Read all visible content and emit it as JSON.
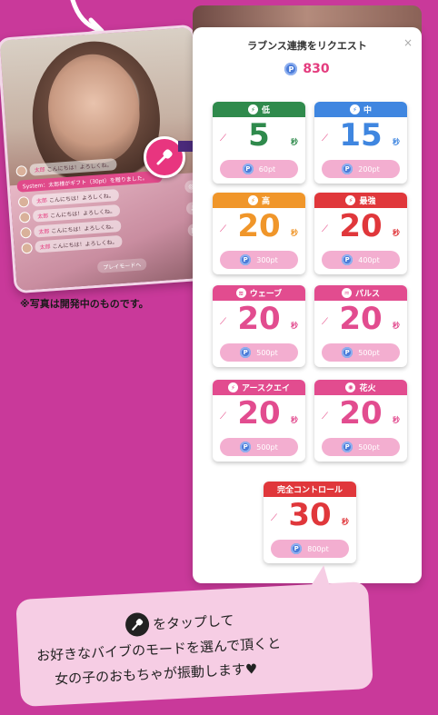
{
  "phone": {
    "system_msg": "System：太郎様がギフト（30pt）を贈りました。",
    "chat": [
      {
        "name": "太郎",
        "text": "こんにちは！よろしくね。"
      },
      {
        "name": "太郎",
        "text": "こんにちは！よろしくね。"
      },
      {
        "name": "太郎",
        "text": "こんにちは！よろしくね。"
      },
      {
        "name": "太郎",
        "text": "こんにちは！よろしくね。"
      },
      {
        "name": "太郎",
        "text": "こんにちは！よろしくね。"
      }
    ],
    "bottom_tag": "プレイモードへ"
  },
  "note": "※写真は開発中のものです。",
  "panel": {
    "title": "ラブンス連携をリクエスト",
    "close": "×",
    "coin": "P",
    "balance": "830",
    "unit": "秒",
    "options": [
      {
        "label": "低",
        "num": "5",
        "price": "60pt",
        "color": "#2f8a4c",
        "num_color": "#2f8a4c",
        "icon": "⚡"
      },
      {
        "label": "中",
        "num": "15",
        "price": "200pt",
        "color": "#3f86e0",
        "num_color": "#3f86e0",
        "icon": "⚡"
      },
      {
        "label": "高",
        "num": "20",
        "price": "300pt",
        "color": "#f0962a",
        "num_color": "#f0962a",
        "icon": "⚡"
      },
      {
        "label": "最強",
        "num": "20",
        "price": "400pt",
        "color": "#e0373b",
        "num_color": "#e0373b",
        "icon": "⚡"
      },
      {
        "label": "ウェーブ",
        "num": "20",
        "price": "500pt",
        "color": "#e24c8f",
        "num_color": "#e24c8f",
        "icon": "≋"
      },
      {
        "label": "パルス",
        "num": "20",
        "price": "500pt",
        "color": "#e24c8f",
        "num_color": "#e24c8f",
        "icon": "♒"
      },
      {
        "label": "アースクエイ",
        "num": "20",
        "price": "500pt",
        "color": "#e24c8f",
        "num_color": "#e24c8f",
        "icon": "⚡"
      },
      {
        "label": "花火",
        "num": "20",
        "price": "500pt",
        "color": "#e24c8f",
        "num_color": "#e24c8f",
        "icon": "✺"
      },
      {
        "label": "完全コントロール",
        "num": "30",
        "price": "800pt",
        "color": "#e0373b",
        "num_color": "#e0373b",
        "icon": ""
      }
    ]
  },
  "bubble": {
    "line1": "をタップして",
    "line2": "お好きなバイブのモードを選んで頂くと",
    "line3": "女の子のおもちゃが振動します♥"
  }
}
